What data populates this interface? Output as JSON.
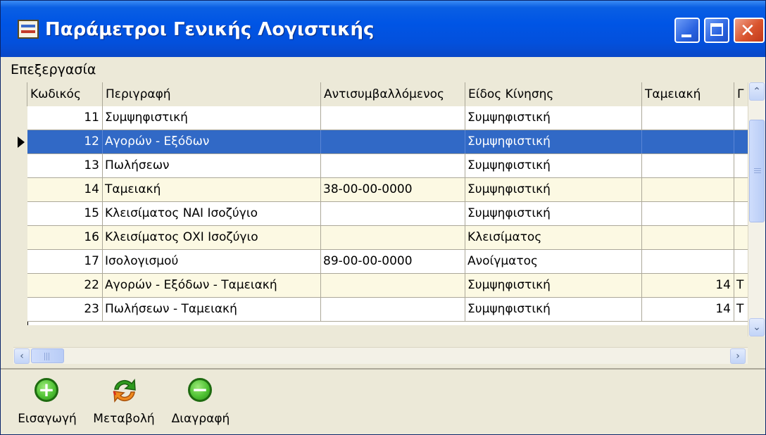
{
  "window": {
    "title": "Παράμετροι Γενικής Λογιστικής",
    "icon": "app-window-icon",
    "controls": {
      "minimize_icon": "minimize-icon",
      "maximize_icon": "maximize-icon",
      "close_icon": "close-icon",
      "close_glyph": "✕"
    }
  },
  "menu": {
    "items": [
      {
        "label": "Επεξεργασία"
      }
    ]
  },
  "grid": {
    "columns": [
      "Κωδικός",
      "Περιγραφή",
      "Αντισυμβαλλόμενος",
      "Είδος Κίνησης",
      "Ταμειακή",
      "Γ"
    ],
    "selected_row_index": 1,
    "rows": [
      {
        "code": "11",
        "description": "Συμψηφιστική",
        "counterparty": "",
        "movement_type": "Συμψηφιστική",
        "cash": "",
        "extra": ""
      },
      {
        "code": "12",
        "description": "Αγορών - Εξόδων",
        "counterparty": "",
        "movement_type": "Συμψηφιστική",
        "cash": "",
        "extra": ""
      },
      {
        "code": "13",
        "description": "Πωλήσεων",
        "counterparty": "",
        "movement_type": "Συμψηφιστική",
        "cash": "",
        "extra": ""
      },
      {
        "code": "14",
        "description": "Ταμειακή",
        "counterparty": "38-00-00-0000",
        "movement_type": "Συμψηφιστική",
        "cash": "",
        "extra": ""
      },
      {
        "code": "15",
        "description": "Κλεισίματος ΝΑΙ Ισοζύγιο",
        "counterparty": "",
        "movement_type": "Συμψηφιστική",
        "cash": "",
        "extra": ""
      },
      {
        "code": "16",
        "description": "Κλεισίματος ΟΧΙ Ισοζύγιο",
        "counterparty": "",
        "movement_type": "Κλεισίματος",
        "cash": "",
        "extra": ""
      },
      {
        "code": "17",
        "description": "Ισολογισμού",
        "counterparty": "89-00-00-0000",
        "movement_type": "Ανοίγματος",
        "cash": "",
        "extra": ""
      },
      {
        "code": "22",
        "description": "Αγορών - Εξόδων - Ταμειακή",
        "counterparty": "",
        "movement_type": "Συμψηφιστική",
        "cash": "14",
        "extra": "Τ"
      },
      {
        "code": "23",
        "description": "Πωλήσεων - Ταμειακή",
        "counterparty": "",
        "movement_type": "Συμψηφιστική",
        "cash": "14",
        "extra": "Τ"
      }
    ]
  },
  "scrollbars": {
    "up_glyph": "⌃",
    "down_glyph": "⌄",
    "left_glyph": "‹",
    "right_glyph": "›"
  },
  "toolbar": {
    "insert": {
      "label": "Εισαγωγή",
      "icon": "add-icon",
      "glyph": "+"
    },
    "modify": {
      "label": "Μεταβολή",
      "icon": "refresh-icon"
    },
    "delete": {
      "label": "Διαγραφή",
      "icon": "remove-icon",
      "glyph": "−"
    }
  },
  "colors": {
    "title_bar": "#0055E5",
    "selection": "#3169C6",
    "alt_row": "#FCF9E3",
    "close_button": "#D9542E",
    "add_icon": "#4FC234",
    "face": "#ECE9D8"
  }
}
